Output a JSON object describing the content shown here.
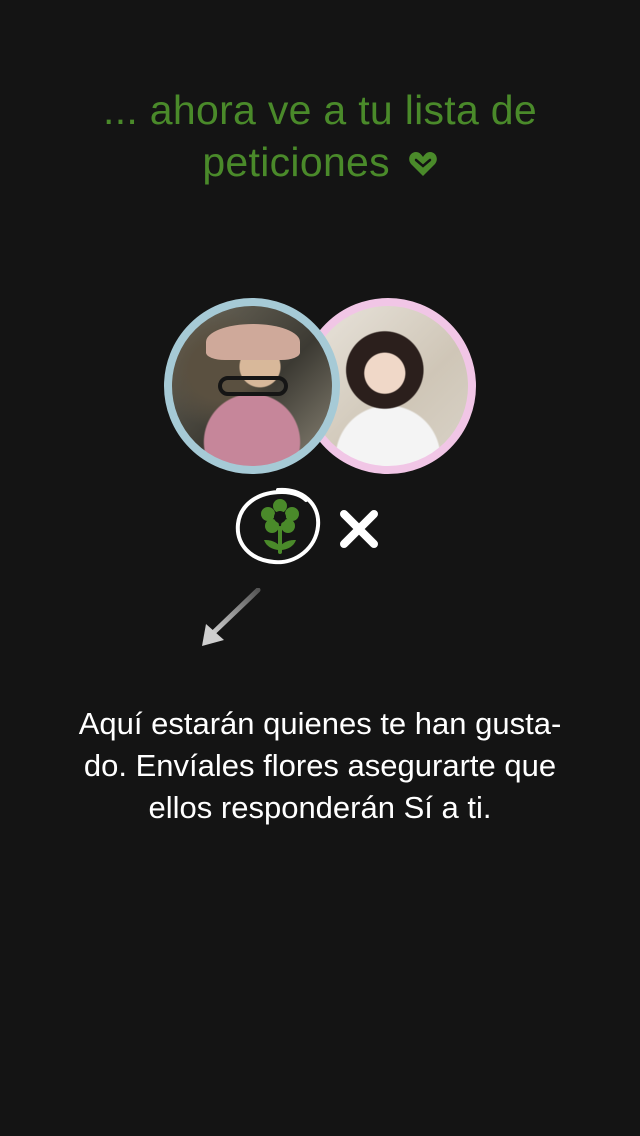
{
  "header": {
    "title_line1": "... ahora ve a tu lista de",
    "title_line2": "peticiones",
    "title_icon": "heart-icon",
    "accent_color": "#4a8a2a"
  },
  "match": {
    "left_avatar_border": "#a6cad6",
    "right_avatar_border": "#f1c6e6",
    "flower_icon": "flower-icon",
    "close_icon": "close-icon",
    "arrow_icon": "arrow-down-left-icon"
  },
  "message": {
    "line1": "Aquí estarán quienes te han gusta-",
    "line2": "do. Envíales flores asegurarte que",
    "line3": "ellos responderán Sí a ti."
  }
}
